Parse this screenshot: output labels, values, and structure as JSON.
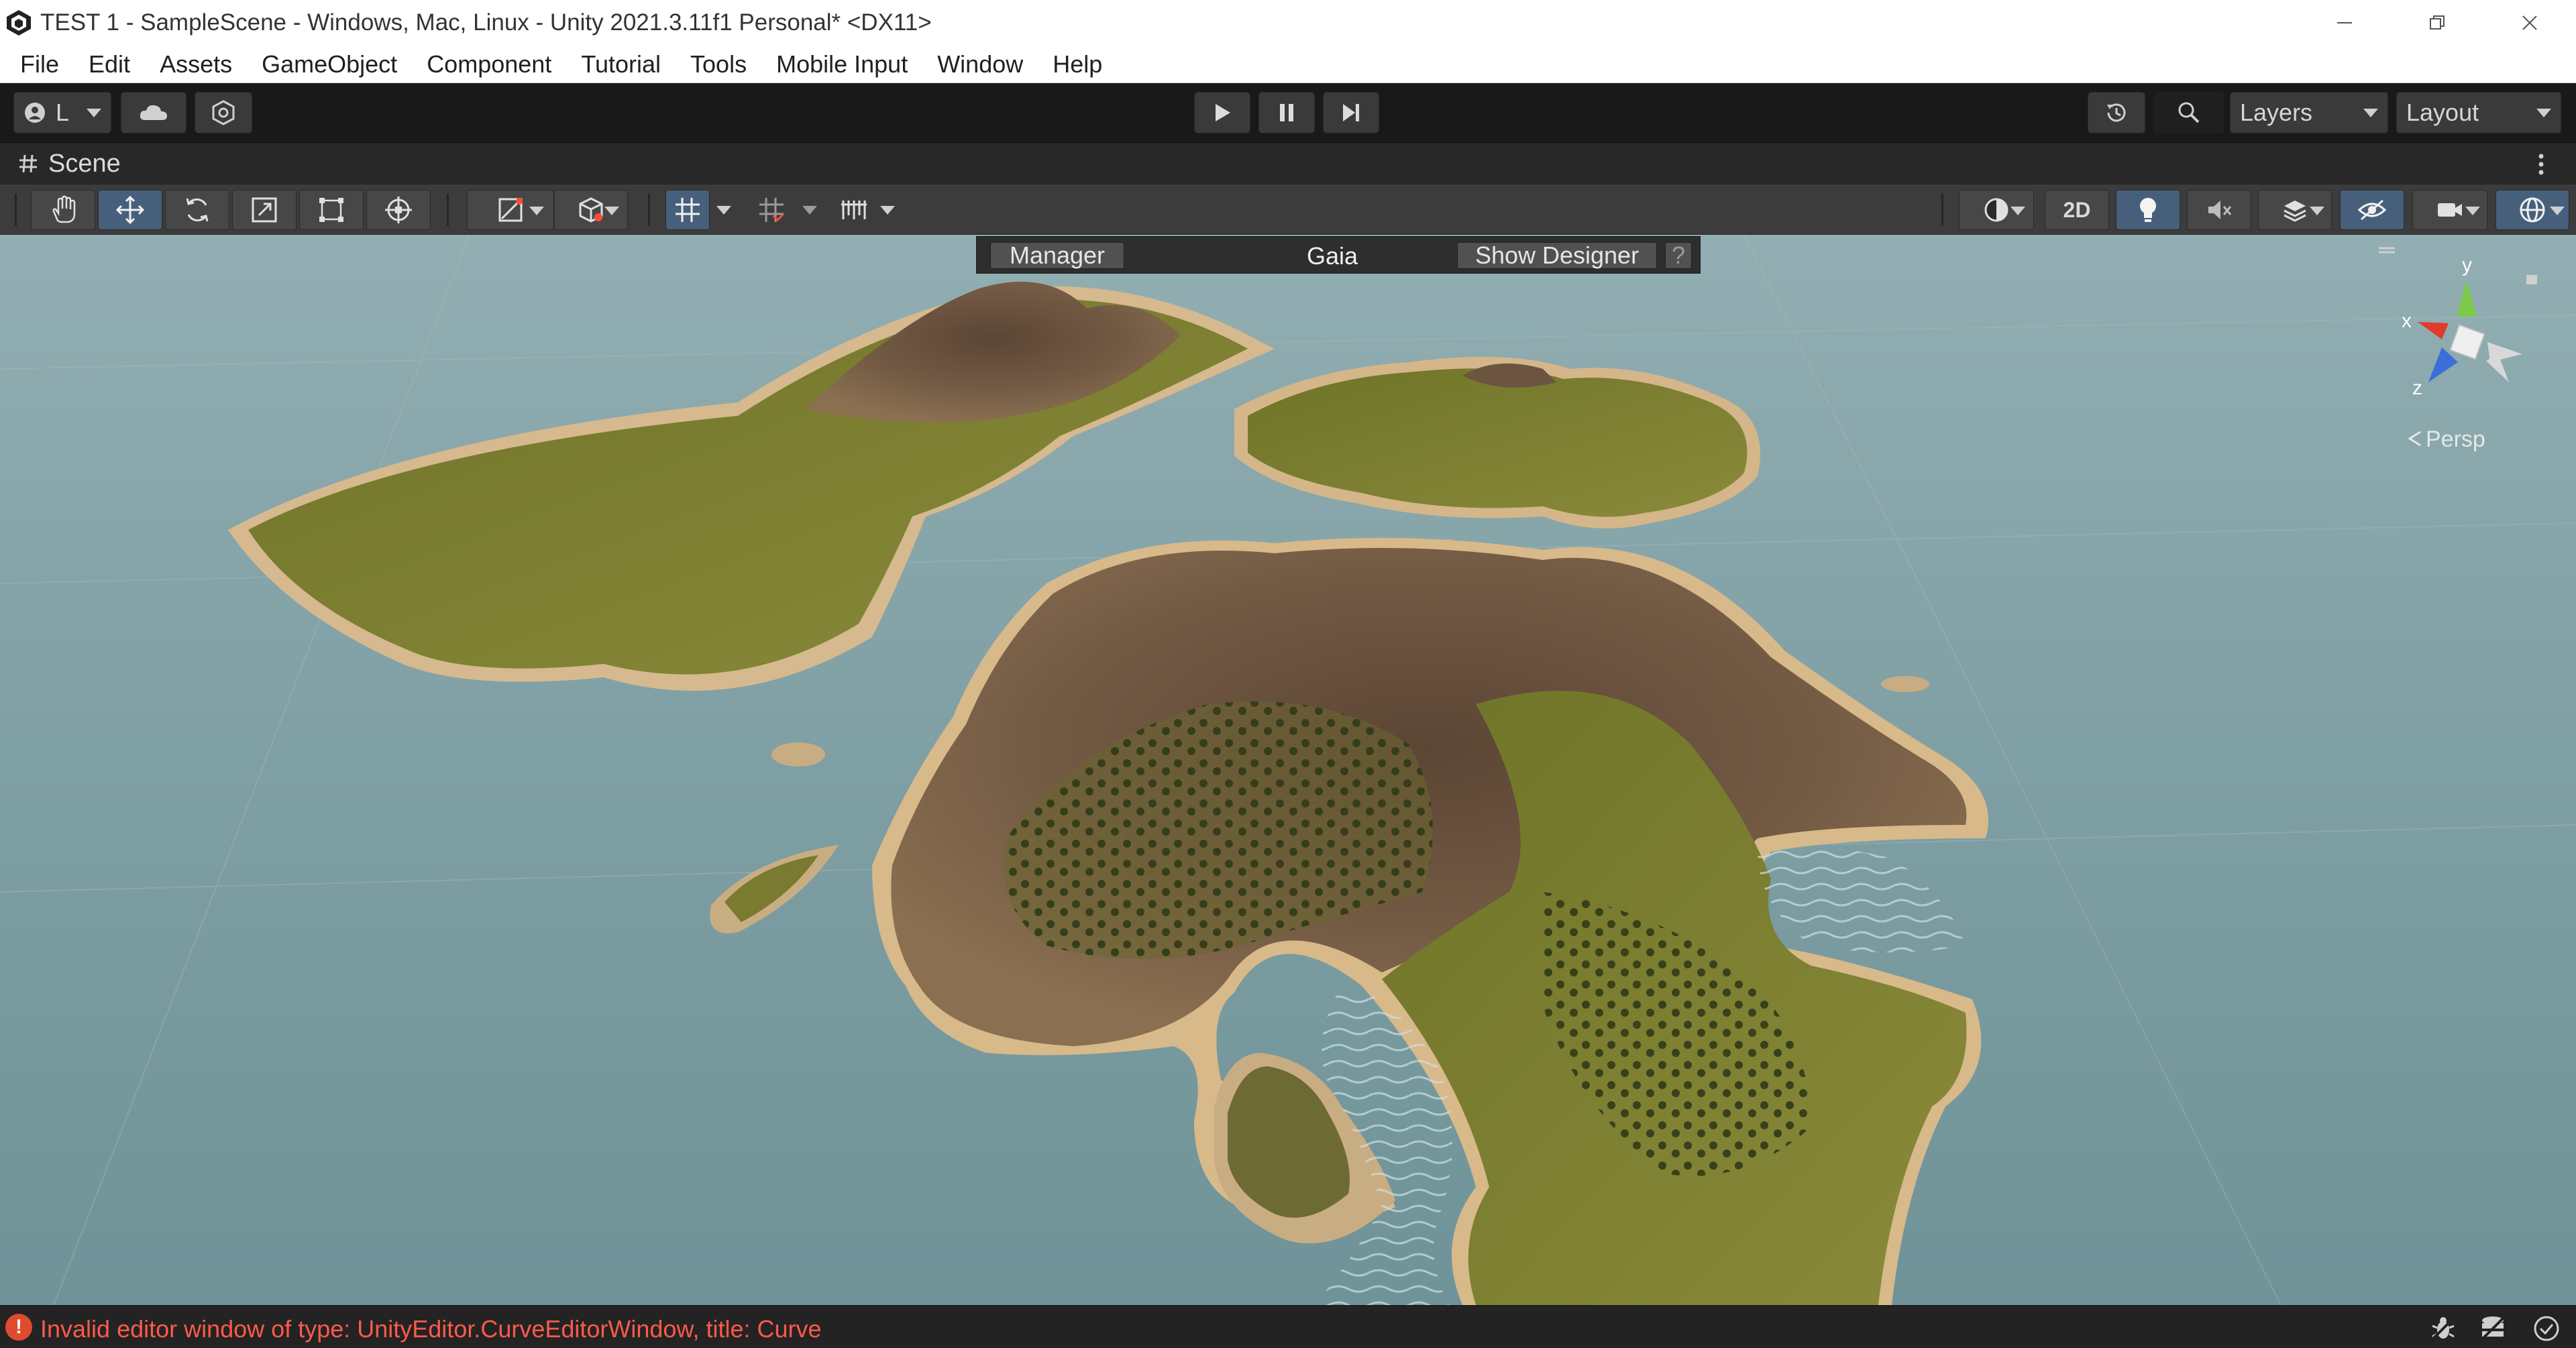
{
  "window": {
    "title": "TEST 1 - SampleScene - Windows, Mac, Linux - Unity 2021.3.11f1 Personal* <DX11>"
  },
  "menu": [
    "File",
    "Edit",
    "Assets",
    "GameObject",
    "Component",
    "Tutorial",
    "Tools",
    "Mobile Input",
    "Window",
    "Help"
  ],
  "toolbar": {
    "account_label": "L",
    "layers_label": "Layers",
    "layout_label": "Layout"
  },
  "scene": {
    "tab_label": "Scene",
    "mode_2d_label": "2D",
    "persp_label": "Persp",
    "gizmo_axes": {
      "x": "x",
      "y": "y",
      "z": "z"
    }
  },
  "gaia": {
    "manager_label": "Manager",
    "title": "Gaia",
    "show_designer_label": "Show Designer",
    "help_label": "?"
  },
  "status": {
    "error_icon": "!",
    "error_text": "Invalid editor window of type: UnityEditor.CurveEditorWindow, title: Curve"
  },
  "colors": {
    "accent_active": "#46607c",
    "error": "#ff5a4a",
    "water": "#7e9fa4",
    "grass": "#7a7d30",
    "rock": "#6b5540",
    "sand": "#d2b48c"
  }
}
